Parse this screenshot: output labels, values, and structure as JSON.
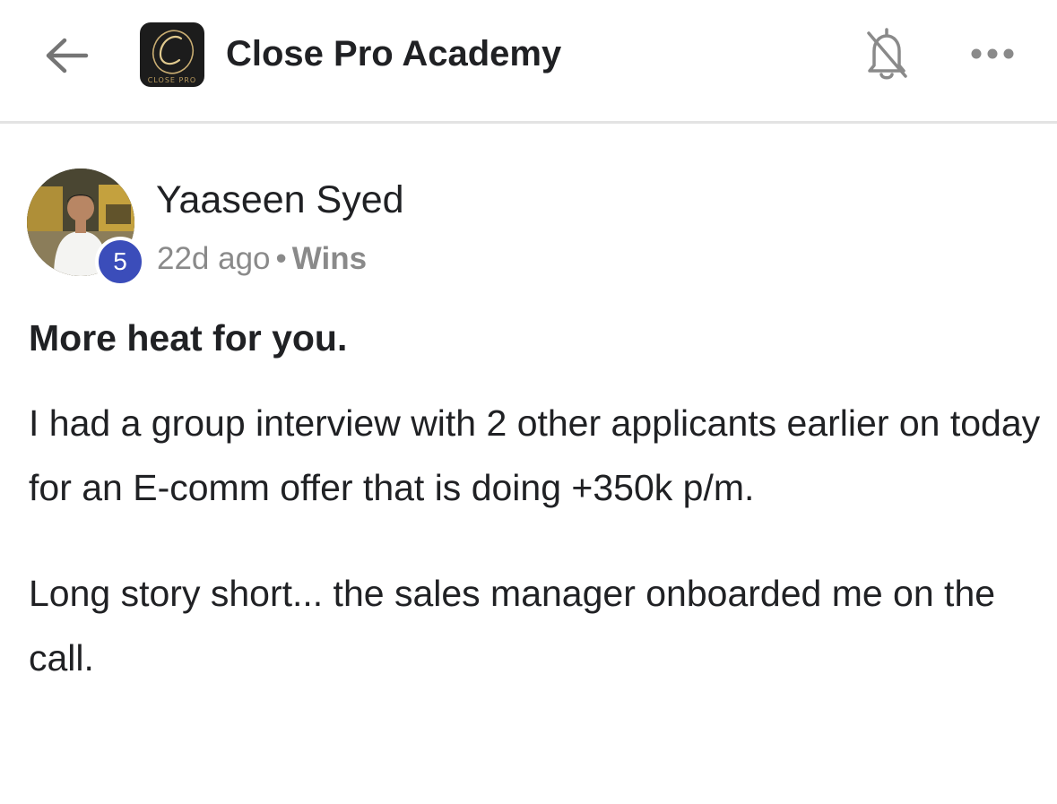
{
  "header": {
    "back_icon": "arrow-left-icon",
    "logo_caption": "CLOSE PRO",
    "group_title": "Close Pro Academy",
    "bell_icon": "bell-off-icon",
    "more_icon": "more-horizontal-icon"
  },
  "post": {
    "author": {
      "name": "Yaaseen Syed",
      "level": "5",
      "level_badge_color": "#3b4dba"
    },
    "time": "22d ago",
    "separator": "•",
    "category": "Wins",
    "title": "More heat for you.",
    "paragraphs": [
      "I had a group interview with 2 other applicants earlier on today for an E-comm offer that is doing +350k p/m.",
      "Long story short... the sales manager onboarded me on the call."
    ]
  }
}
